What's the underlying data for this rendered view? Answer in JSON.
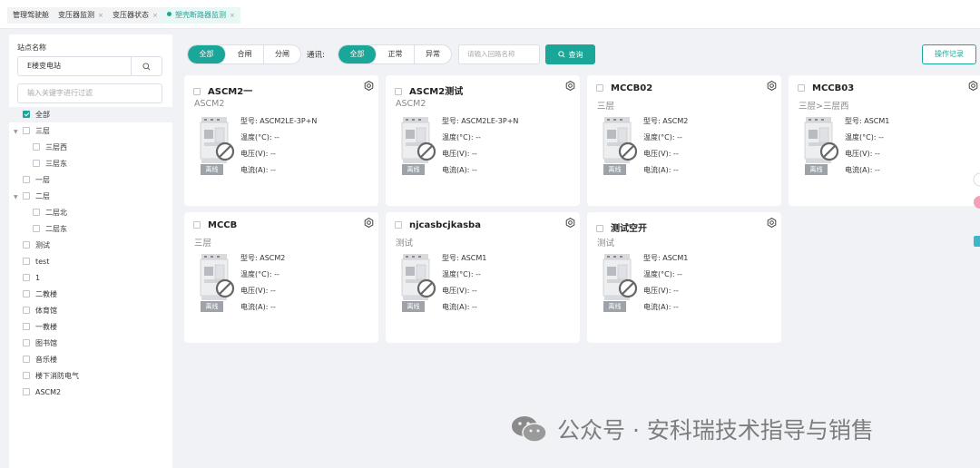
{
  "tabs": [
    {
      "label": "管理驾驶舱",
      "closable": false,
      "active": false
    },
    {
      "label": "变压器监测",
      "closable": true,
      "active": false
    },
    {
      "label": "变压器状态",
      "closable": true,
      "active": false
    },
    {
      "label": "塑壳断路器监测",
      "closable": true,
      "active": true
    }
  ],
  "tab_close_glyph": "×",
  "sidebar": {
    "station_label": "站点名称",
    "station_value": "E楼变电站",
    "filter_placeholder": "输入关键字进行过滤",
    "tree": [
      {
        "label": "全部",
        "checked": true,
        "level": 0
      },
      {
        "label": "三层",
        "expandable": true,
        "level": 0
      },
      {
        "label": "三层西",
        "level": 1
      },
      {
        "label": "三层东",
        "level": 1
      },
      {
        "label": "一层",
        "level": 0
      },
      {
        "label": "二层",
        "expandable": true,
        "level": 0
      },
      {
        "label": "二层北",
        "level": 1
      },
      {
        "label": "二层东",
        "level": 1
      },
      {
        "label": "测试",
        "level": 0
      },
      {
        "label": "test",
        "level": 0
      },
      {
        "label": "1",
        "level": 0
      },
      {
        "label": "二教楼",
        "level": 0
      },
      {
        "label": "体育馆",
        "level": 0
      },
      {
        "label": "一教楼",
        "level": 0
      },
      {
        "label": "图书馆",
        "level": 0
      },
      {
        "label": "音乐楼",
        "level": 0
      },
      {
        "label": "楼下消防电气",
        "level": 0
      },
      {
        "label": "ASCM2",
        "level": 0
      }
    ]
  },
  "toolbar": {
    "switch_filter": [
      "全部",
      "合闸",
      "分闸"
    ],
    "comm_label": "通讯:",
    "comm_filter": [
      "全部",
      "正常",
      "异常"
    ],
    "circuit_placeholder": "请输入回路名称",
    "query_label": "查询",
    "log_label": "操作记录"
  },
  "field_labels": {
    "model": "型号:",
    "temperature": "温度(°C):",
    "voltage": "电压(V):",
    "current": "电流(A):",
    "empty": "--",
    "offline": "离线"
  },
  "cards": [
    {
      "title": "ASCM2一",
      "location": "ASCM2",
      "model": "ASCM2LE-3P+N",
      "status": "离线"
    },
    {
      "title": "ASCM2测试",
      "location": "ASCM2",
      "model": "ASCM2LE-3P+N",
      "status": "离线"
    },
    {
      "title": "MCCB02",
      "location": "三层",
      "model": "ASCM2",
      "status": "离线"
    },
    {
      "title": "MCCB03",
      "location": "三层>三层西",
      "model": "ASCM1",
      "status": "离线"
    },
    {
      "title": "MCCB",
      "location": "三层",
      "model": "ASCM2",
      "status": "离线"
    },
    {
      "title": "njcasbcjkasba",
      "location": "测试",
      "model": "ASCM1",
      "status": "离线"
    },
    {
      "title": "测试空开",
      "location": "测试",
      "model": "ASCM1",
      "status": "离线"
    }
  ],
  "watermark": "公众号 · 安科瑞技术指导与销售",
  "colors": {
    "accent": "#1aa79a",
    "offline_badge": "#9ea3a9"
  },
  "icons": [
    "search-icon",
    "gear-icon",
    "wechat-icon",
    "breaker-offline-icon"
  ]
}
